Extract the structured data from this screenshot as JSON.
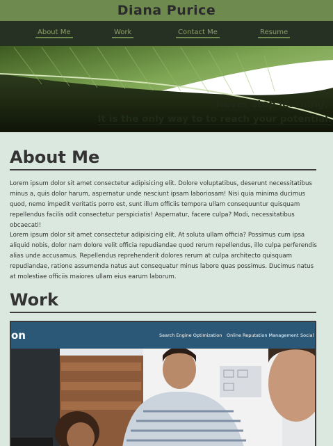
{
  "site": {
    "title": "Diana Purice"
  },
  "nav": {
    "items": [
      "About Me",
      "Work",
      "Contact Me",
      "Resume"
    ]
  },
  "hero": {
    "line1": "Never stop learning.",
    "line2": "It is the only way to to reach your potential."
  },
  "about": {
    "heading": "About Me",
    "p1": "Lorem ipsum dolor sit amet consectetur adipisicing elit. Dolore voluptatibus, deserunt necessitatibus minus a, quis dolor harum, aspernatur unde nesciunt ipsam laboriosam! Nisi quia minima ducimus quod, nemo impedit veritatis porro est, sunt illum officiis tempora ullam consequuntur quisquam repellendus facilis odit consectetur perspiciatis! Aspernatur, facere culpa? Modi, necessitatibus obcaecati!",
    "p2": "Lorem ipsum dolor sit amet consectetur adipisicing elit. At soluta ullam officia? Possimus cum ipsa aliquid nobis, dolor nam dolore velit officia repudiandae quod rerum repellendus, illo culpa perferendis alias unde accusamus. Repellendus reprehenderit dolores rerum at culpa architecto quisquam repudiandae, ratione assumenda natus aut consequatur minus labore quas possimus. Ducimus natus at molestiae officiis maiores ullam eius earum laborum."
  },
  "work": {
    "heading": "Work",
    "screenshot": {
      "brand": "on",
      "menu": [
        "Search Engine Optimization",
        "Online Reputation Management",
        "Social M"
      ]
    }
  },
  "colors": {
    "title_bar": "#6f8a4f",
    "nav_bar": "#263023",
    "nav_link": "#8aa06a",
    "page_bg": "#dbe8e0",
    "work_bar": "#2b5877"
  }
}
